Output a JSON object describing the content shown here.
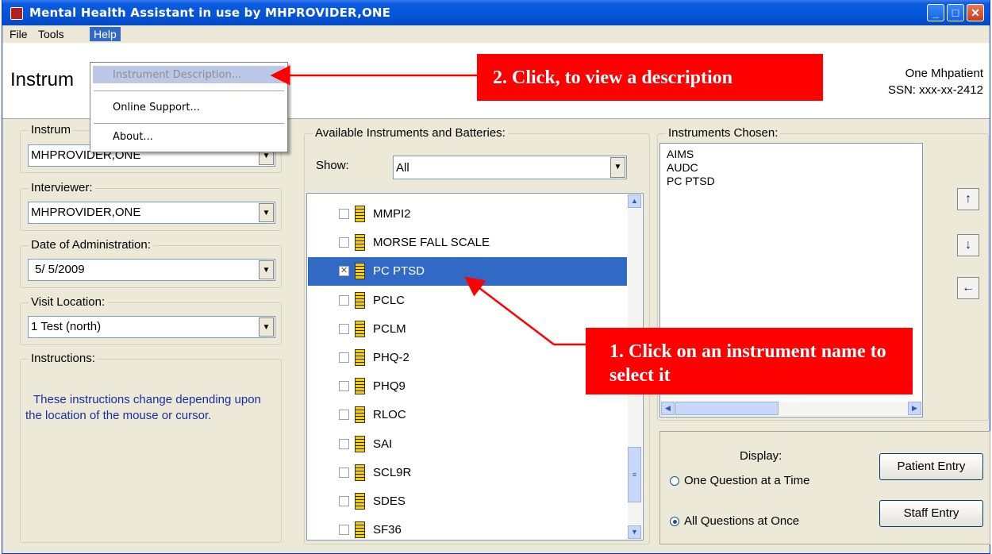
{
  "window": {
    "title": "Mental Health Assistant in use by MHPROVIDER,ONE",
    "controls": {
      "minimize": "_",
      "maximize": "□",
      "close": "✕"
    }
  },
  "menu": {
    "file": "File",
    "tools": "Tools",
    "help": "Help"
  },
  "help_menu": {
    "instrument_description": "Instrument Description...",
    "online_support": "Online Support...",
    "about": "About..."
  },
  "header": {
    "title": "Instrum",
    "patient_name": "One Mhpatient",
    "ssn": "SSN: xxx-xx-2412"
  },
  "left": {
    "instrument_label": "Instrum",
    "instrument_value": "MHPROVIDER,ONE",
    "interviewer_label": "Interviewer:",
    "interviewer_value": "MHPROVIDER,ONE",
    "date_label": "Date of Administration:",
    "date_value": "5/ 5/2009",
    "location_label": "Visit Location:",
    "location_value": "1 Test (north)",
    "instructions_label": "Instructions:",
    "instructions_text": "These instructions change depending upon the location of the mouse or cursor."
  },
  "available": {
    "label": "Available Instruments and Batteries:",
    "show_label": "Show:",
    "show_value": "All",
    "items": [
      {
        "name": "MMPI2",
        "checked": false
      },
      {
        "name": "MORSE FALL SCALE",
        "checked": false
      },
      {
        "name": "PC PTSD",
        "checked": true
      },
      {
        "name": "PCLC",
        "checked": false
      },
      {
        "name": "PCLM",
        "checked": false
      },
      {
        "name": "PHQ-2",
        "checked": false
      },
      {
        "name": "PHQ9",
        "checked": false
      },
      {
        "name": "RLOC",
        "checked": false
      },
      {
        "name": "SAI",
        "checked": false
      },
      {
        "name": "SCL9R",
        "checked": false
      },
      {
        "name": "SDES",
        "checked": false
      },
      {
        "name": "SF36",
        "checked": false
      }
    ]
  },
  "chosen": {
    "label": "Instruments Chosen:",
    "items": [
      "AIMS",
      "AUDC",
      "PC PTSD"
    ]
  },
  "display": {
    "label": "Display:",
    "one_question": "One Question at a Time",
    "all_questions": "All Questions at Once",
    "selected": "all_questions"
  },
  "buttons": {
    "patient_entry": "Patient Entry",
    "staff_entry": "Staff Entry"
  },
  "callouts": {
    "step1": "1. Click on an instrument name to select it",
    "step2": "2. Click, to view a description"
  },
  "colors": {
    "callout": "#ff0000",
    "selection": "#316ac5",
    "titlebar": "#0554d8"
  }
}
